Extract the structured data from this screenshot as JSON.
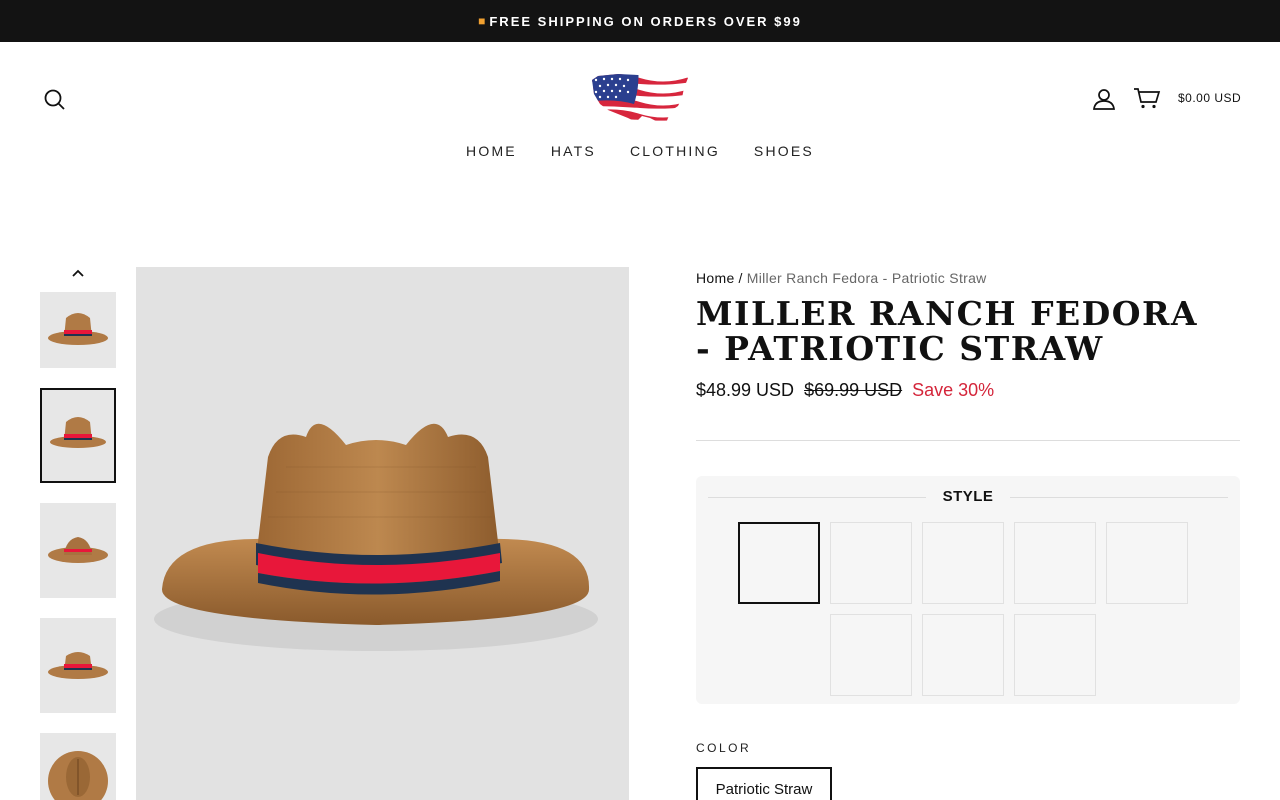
{
  "announcement": {
    "icon": "truck-icon",
    "text": "FREE SHIPPING ON ORDERS OVER $99"
  },
  "header": {
    "logo": "american-flag-map-logo",
    "cart_total": "$0.00 USD"
  },
  "nav": {
    "items": [
      "HOME",
      "HATS",
      "CLOTHING",
      "SHOES"
    ]
  },
  "gallery": {
    "thumbnails_visible": 5,
    "active_thumbnail": 2
  },
  "product": {
    "breadcrumb_home": "Home",
    "breadcrumb_sep": "/",
    "breadcrumb_current": "Miller Ranch Fedora - Patriotic Straw",
    "title": "MILLER RANCH FEDORA - PATRIOTIC STRAW",
    "price": "$48.99 USD",
    "compare_price": "$69.99 USD",
    "save_label": "Save 30%"
  },
  "style_selector": {
    "label": "STYLE",
    "option_count": 8,
    "selected_index": 0
  },
  "color_selector": {
    "label": "COLOR",
    "selected": "Patriotic Straw"
  },
  "colors": {
    "sale_red": "#d4253a",
    "announcement_bg": "#131313",
    "straw": "#b07a45",
    "band_red": "#e8173a",
    "band_navy": "#1f3350"
  }
}
